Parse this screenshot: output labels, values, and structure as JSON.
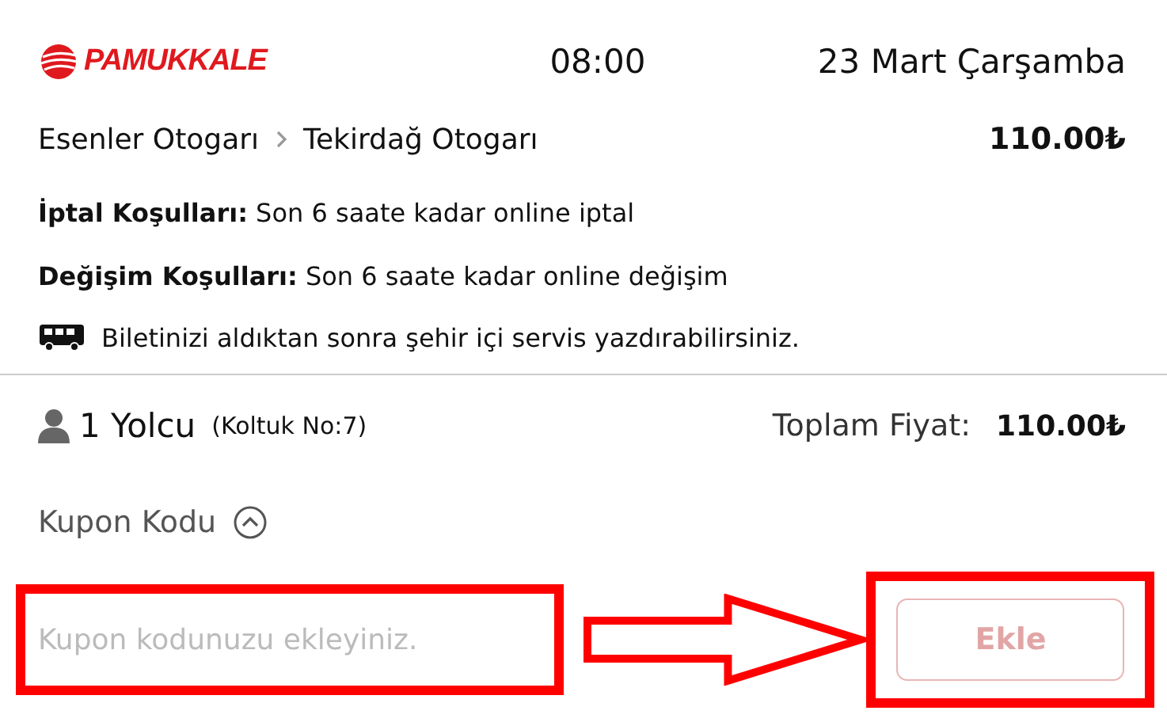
{
  "header": {
    "logo": "PAMUKKALE",
    "time": "08:00",
    "date": "23 Mart Çarşamba"
  },
  "route": {
    "from": "Esenler Otogarı",
    "to": "Tekirdağ Otogarı",
    "price": "110.00₺"
  },
  "conditions": [
    {
      "text": "**İptal Koşulları:** Son 6 saate kadar online iptal"
    },
    {
      "text": "**Değişim Koşulları:** Son 6 saate kadar online değişim"
    }
  ],
  "notice": "Biletinizi aldıktan sonra şehir içi servis yazdırabilirsiniz.",
  "passenger": {
    "count": "1 Yolcu",
    "seat": "(Koltuk No:7)",
    "total_label": "Toplam Fiyat:",
    "total": "110.00₺"
  },
  "coupon": {
    "label": "Kupon Kodu",
    "expanded": true,
    "placeholder": "Kupon kodunuzu ekleyiniz.",
    "button": "Ekle",
    "button_disabled": true
  }
}
